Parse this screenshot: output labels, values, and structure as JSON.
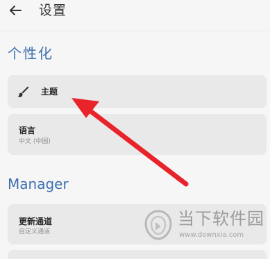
{
  "header": {
    "back_icon": "arrow-left-icon",
    "title": "设置"
  },
  "sections": {
    "personalize": {
      "title": "个性化",
      "theme": {
        "icon": "paint-brush-icon",
        "label": "主题"
      },
      "language": {
        "label": "语言",
        "value": "中文 (中国)"
      }
    },
    "manager": {
      "title": "Manager",
      "update_channel": {
        "label": "更新通道",
        "value": "自定义通道"
      }
    }
  },
  "annotation": {
    "arrow_color": "#e8232a"
  },
  "watermark": {
    "name": "当下软件园",
    "url": "www.downxia.com"
  },
  "colors": {
    "accent": "#3d6fae",
    "background": "#f6f6f6",
    "card": "#e9e9e9"
  }
}
